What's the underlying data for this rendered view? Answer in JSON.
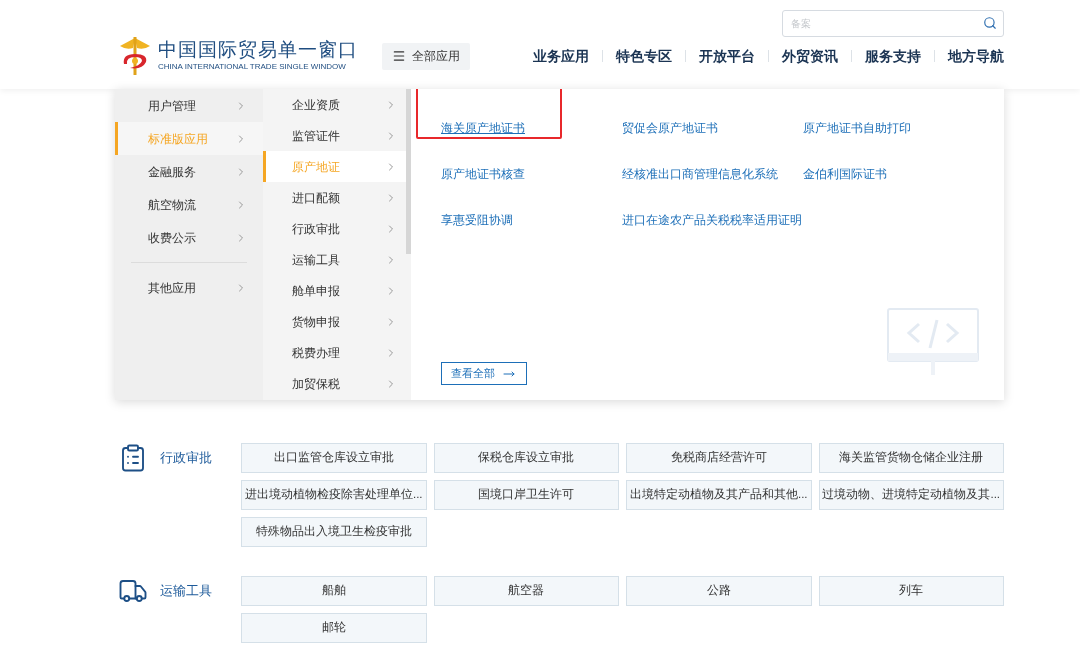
{
  "header": {
    "logo_title": "中国国际贸易单一窗口",
    "logo_subtitle": "CHINA INTERNATIONAL TRADE SINGLE WINDOW",
    "all_apps_button": "全部应用",
    "search": {
      "placeholder": "备案"
    },
    "nav": [
      "业务应用",
      "特色专区",
      "开放平台",
      "外贸资讯",
      "服务支持",
      "地方导航"
    ]
  },
  "menu": {
    "level1_groups": [
      [
        {
          "label": "用户管理",
          "selected": false
        },
        {
          "label": "标准版应用",
          "selected": true
        },
        {
          "label": "金融服务",
          "selected": false
        },
        {
          "label": "航空物流",
          "selected": false
        },
        {
          "label": "收费公示",
          "selected": false
        }
      ],
      [
        {
          "label": "其他应用",
          "selected": false
        }
      ]
    ],
    "level2": [
      {
        "label": "企业资质",
        "selected": false
      },
      {
        "label": "监管证件",
        "selected": false
      },
      {
        "label": "原产地证",
        "selected": true
      },
      {
        "label": "进口配额",
        "selected": false
      },
      {
        "label": "行政审批",
        "selected": false
      },
      {
        "label": "运输工具",
        "selected": false
      },
      {
        "label": "舱单申报",
        "selected": false
      },
      {
        "label": "货物申报",
        "selected": false
      },
      {
        "label": "税费办理",
        "selected": false
      },
      {
        "label": "加贸保税",
        "selected": false
      }
    ],
    "links": [
      {
        "label": "海关原产地证书",
        "selected": true
      },
      {
        "label": "贸促会原产地证书",
        "selected": false
      },
      {
        "label": "原产地证书自助打印",
        "selected": false
      },
      {
        "label": "原产地证书核查",
        "selected": false
      },
      {
        "label": "经核准出口商管理信息化系统",
        "selected": false
      },
      {
        "label": "金伯利国际证书",
        "selected": false
      },
      {
        "label": "享惠受阻协调",
        "selected": false
      },
      {
        "label": "进口在途农产品关税税率适用证明",
        "selected": false
      }
    ],
    "view_all": "查看全部"
  },
  "sections": [
    {
      "title": "行政审批",
      "kind": "clipboard",
      "tiles": [
        "出口监管仓库设立审批",
        "保税仓库设立审批",
        "免税商店经营许可",
        "海关监管货物仓储企业注册",
        "进出境动植物检疫除害处理单位...",
        "国境口岸卫生许可",
        "出境特定动植物及其产品和其他...",
        "过境动物、进境特定动植物及其...",
        "特殊物品出入境卫生检疫审批"
      ]
    },
    {
      "title": "运输工具",
      "kind": "truck",
      "tiles": [
        "船舶",
        "航空器",
        "公路",
        "列车",
        "邮轮"
      ]
    }
  ]
}
